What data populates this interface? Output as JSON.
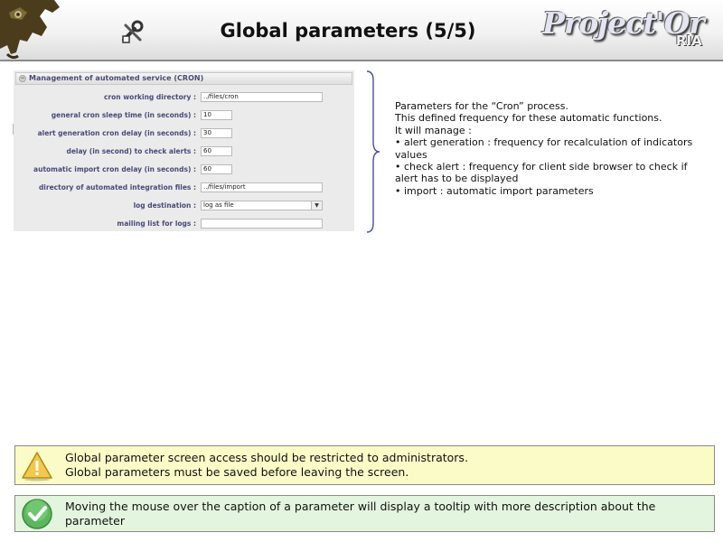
{
  "header": {
    "title": "Global parameters (5/5)",
    "brand_main": "Project'Or",
    "brand_sub": "RIA",
    "logo_icon": "chameleon-logo-icon",
    "tool_icon": "tools-icon"
  },
  "panel": {
    "title": "Management of automated service (CRON)",
    "fields": [
      {
        "label": "cron working directory :",
        "value": "../files/cron"
      },
      {
        "label": "general cron sleep time (in seconds) :",
        "value": "10"
      },
      {
        "label": "alert generation cron delay (in seconds) :",
        "value": "30"
      },
      {
        "label": "delay (in second) to check alerts :",
        "value": "60"
      },
      {
        "label": "automatic import cron delay (in seconds) :",
        "value": "60"
      },
      {
        "label": "directory of automated integration files :",
        "value": "../files/import"
      },
      {
        "label": "log destination :",
        "value": "log as file"
      },
      {
        "label": "mailing list for logs :",
        "value": ""
      }
    ]
  },
  "description": {
    "lines": [
      "Parameters for the “Cron” process.",
      "This defined frequency for these automatic functions.",
      "It will manage :",
      "• alert generation : frequency for recalculation of indicators values",
      "• check alert : frequency for client side browser to check if alert has to be displayed",
      "• import : automatic import parameters"
    ]
  },
  "notes": {
    "warning": {
      "icon": "warning-icon",
      "line1": "Global parameter screen access should be restricted to administrators.",
      "line2": "Global parameters must be saved before leaving the screen."
    },
    "tip": {
      "icon": "checkmark-icon",
      "text": "Moving the mouse over the caption of a parameter will display a tooltip with more description about the parameter"
    }
  },
  "colors": {
    "label": "#4a4a7a",
    "warning_bg": "#fbfbc8",
    "tip_bg": "#e4f5df",
    "brace": "#4a4ab0"
  }
}
